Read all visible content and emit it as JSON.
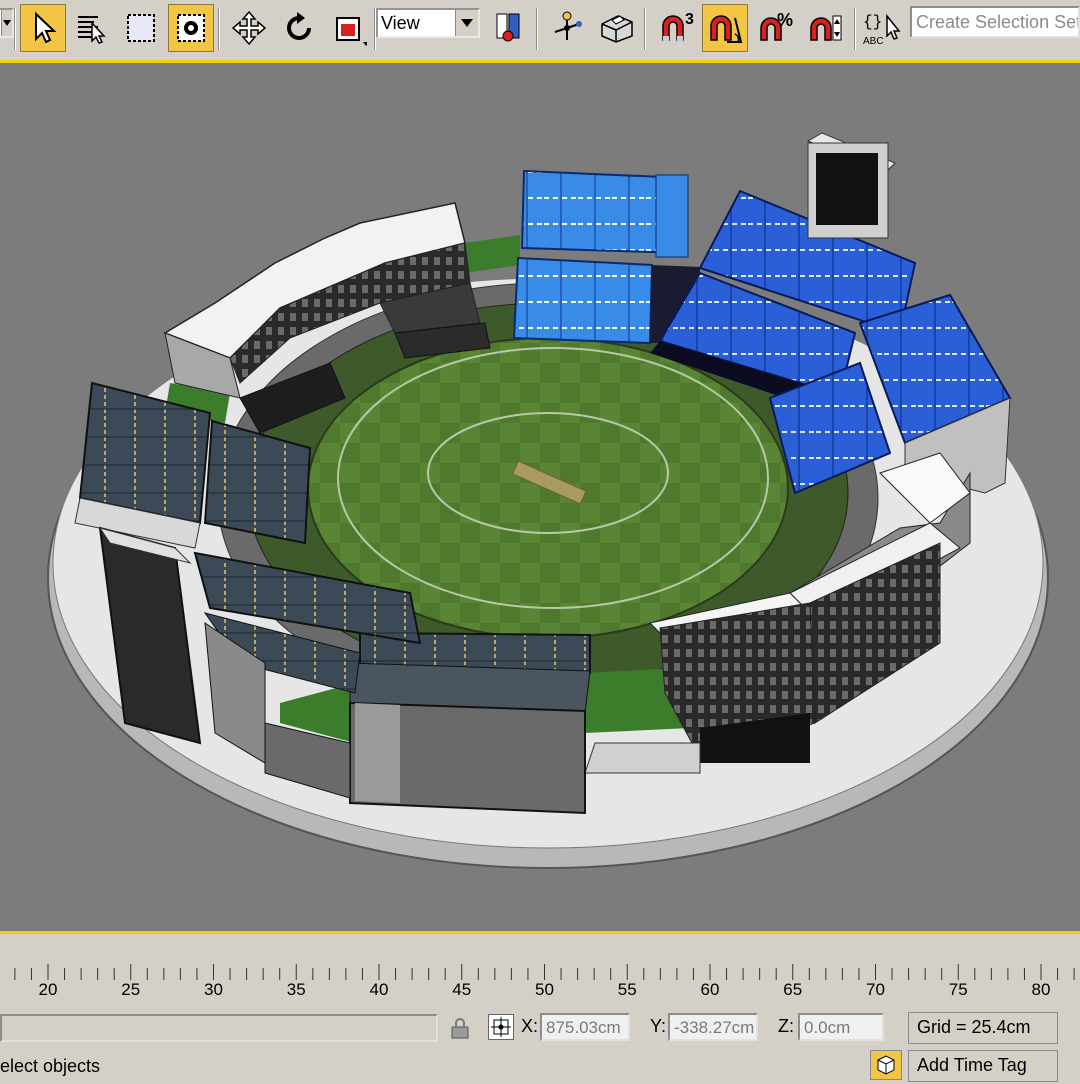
{
  "toolbar": {
    "view_dropdown": "View",
    "create_selection_set_placeholder": "Create Selection Set",
    "angle_snap_superscript": "3",
    "percent_snap_symbol": "%",
    "icons": [
      "select-object-icon",
      "select-by-name-icon",
      "rectangular-selection-icon",
      "window-crossing-icon",
      "move-icon",
      "rotate-icon",
      "scale-icon",
      "use-pivot-center-icon",
      "select-manipulate-icon",
      "keyboard-shortcut-icon",
      "snaps-toggle-icon",
      "angle-snap-icon",
      "percent-snap-icon",
      "spinner-snap-icon",
      "edit-named-selection-icon"
    ],
    "accent_color": "#f2c545"
  },
  "viewport": {
    "background_color": "#7c7c7c",
    "border_color": "#f0d000",
    "scene": "cricket-stadium-model"
  },
  "timeline": {
    "tick_labels": [
      "20",
      "25",
      "30",
      "35",
      "40",
      "45",
      "50",
      "55",
      "60",
      "65",
      "70",
      "75",
      "80"
    ]
  },
  "status": {
    "prompt_text": "elect objects",
    "x_label": "X:",
    "x_value": "875.03cm",
    "y_label": "Y:",
    "y_value": "-338.27cm",
    "z_label": "Z:",
    "z_value": "0.0cm",
    "grid_text": "Grid = 25.4cm",
    "add_time_tag": "Add Time Tag"
  }
}
